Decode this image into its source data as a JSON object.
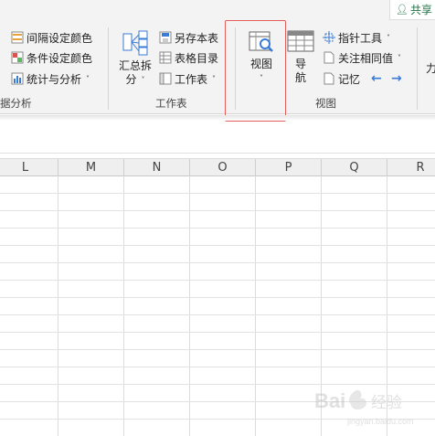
{
  "window": {
    "share_label": "共享"
  },
  "ribbon": {
    "data_group": {
      "label": "据分析",
      "items": [
        {
          "label": "间隔设定颜色"
        },
        {
          "label": "条件设定颜色"
        },
        {
          "label": "统计与分析"
        }
      ]
    },
    "sheet_group": {
      "label": "工作表",
      "summary_split_label_1": "汇总拆",
      "summary_split_label_2": "分",
      "items": [
        {
          "label": "另存本表"
        },
        {
          "label": "表格目录"
        },
        {
          "label": "工作表"
        }
      ]
    },
    "view_group": {
      "label": "视图",
      "view_label": "视图",
      "nav_label_1": "导",
      "nav_label_2": "航",
      "items": [
        {
          "label": "指针工具"
        },
        {
          "label": "关注相同值"
        },
        {
          "label": "记忆"
        }
      ],
      "partial_label": "力"
    }
  },
  "sheet": {
    "columns": [
      "L",
      "M",
      "N",
      "O",
      "P",
      "Q",
      "R"
    ]
  },
  "watermark": {
    "text": "Bai 经验",
    "sub": "jingyan.baidu.com"
  },
  "colors": {
    "accent": "#217346",
    "highlight_border": "#e45c5c",
    "arrow_blue": "#3a7bd5"
  }
}
